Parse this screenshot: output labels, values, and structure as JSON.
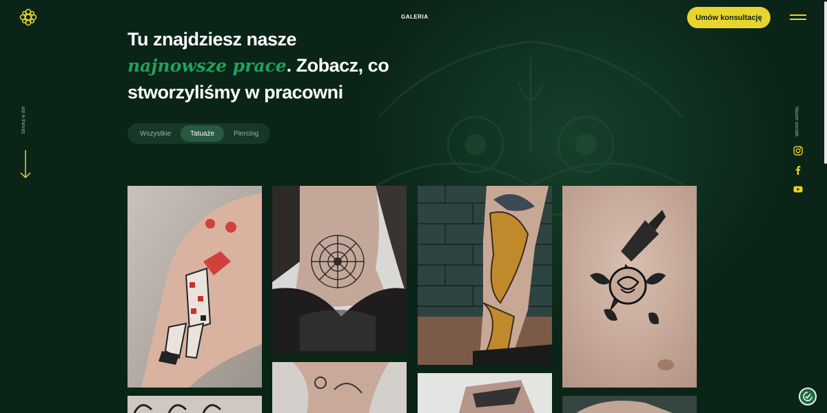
{
  "header": {
    "nav_gallery": "GALERIA",
    "cta_label": "Umów konsultację",
    "logo_icon": "mandala-logo-icon",
    "menu_icon": "hamburger-menu-icon"
  },
  "hero": {
    "line1": "Tu znajdziesz nasze",
    "accent": "najnowsze prace",
    "line2_rest": ". Zobacz, co",
    "line3": "stworzyliśmy w pracowni"
  },
  "filters": {
    "tabs": [
      {
        "label": "Wszystkie",
        "active": false
      },
      {
        "label": "Tatuaże",
        "active": true
      },
      {
        "label": "Piercing",
        "active": false
      }
    ]
  },
  "scroll_hint": {
    "label": "Skroluj w dół",
    "icon": "arrow-down-icon"
  },
  "socials": {
    "label": "Nasze sociale",
    "items": [
      "instagram-icon",
      "facebook-icon",
      "youtube-icon"
    ]
  },
  "gallery": {
    "items": [
      "harlequin-tattoo-forearm",
      "mandala-neck-tattoo",
      "koi-fish-leg-tattoo",
      "dagger-rose-chest-tattoo",
      "tattoo-photo-row2-col1",
      "tattoo-photo-row2-col2",
      "tattoo-photo-row2-col3",
      "tattoo-photo-row2-col4"
    ]
  },
  "colors": {
    "background": "#0b2418",
    "accent_yellow": "#e8d42e",
    "accent_green": "#1fa35a",
    "tab_active": "#285a41"
  }
}
